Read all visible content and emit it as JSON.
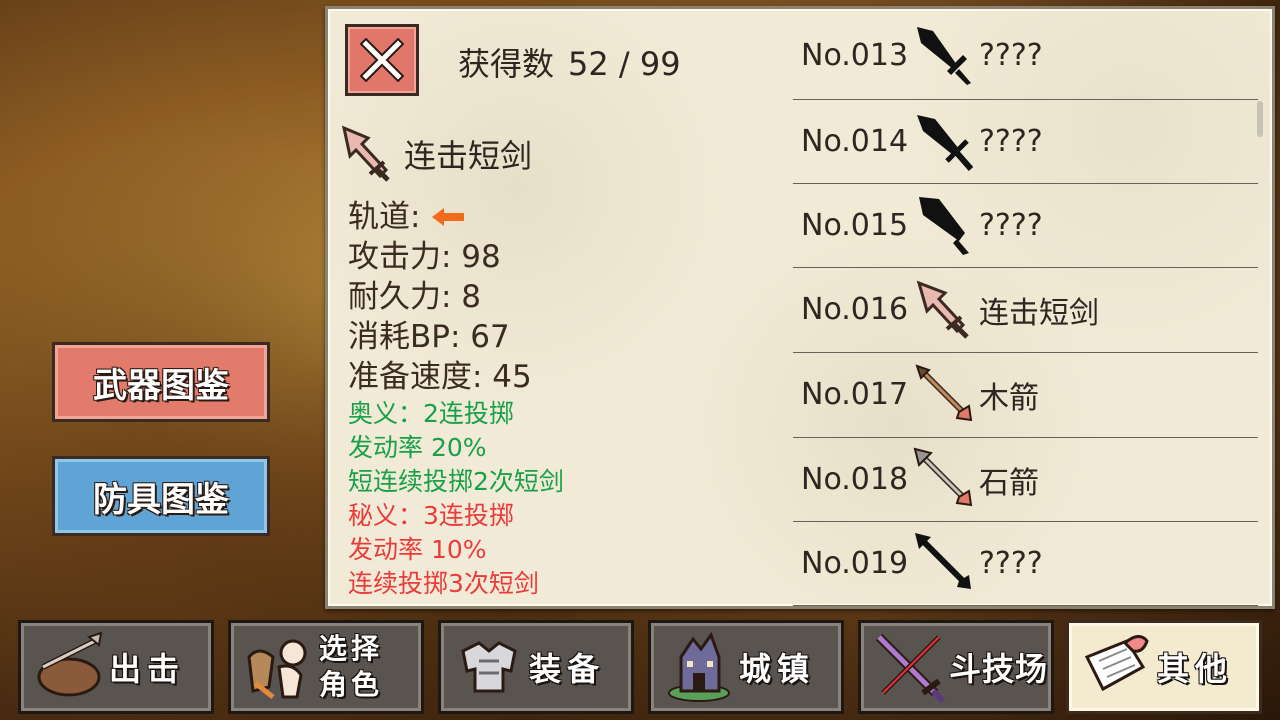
{
  "header": {
    "obtained_label": "获得数",
    "obtained_count": "52 / 99"
  },
  "selected": {
    "name": "连击短剑",
    "track_label": "轨道:",
    "attack": "攻击力: 98",
    "durability": "耐久力: 8",
    "bp_cost": "消耗BP: 67",
    "prep_speed": "准备速度: 45",
    "skill1_title": "奥义：2连投掷",
    "skill1_rate": "发动率 20%",
    "skill1_desc": "短连续投掷2次短剑",
    "skill2_title": "秘义：3连投掷",
    "skill2_rate": "发动率 10%",
    "skill2_desc": "连续投掷3次短剑"
  },
  "list": [
    {
      "no": "No.013",
      "name": "????",
      "icon": "black-sword-icon"
    },
    {
      "no": "No.014",
      "name": "????",
      "icon": "black-dagger-icon"
    },
    {
      "no": "No.015",
      "name": "????",
      "icon": "black-cleaver-icon"
    },
    {
      "no": "No.016",
      "name": "连击短剑",
      "icon": "combo-dagger-icon"
    },
    {
      "no": "No.017",
      "name": "木箭",
      "icon": "wood-arrow-icon"
    },
    {
      "no": "No.018",
      "name": "石箭",
      "icon": "stone-arrow-icon"
    },
    {
      "no": "No.019",
      "name": "????",
      "icon": "black-arrow-icon"
    }
  ],
  "side": {
    "weapon_book": "武器图鉴",
    "armor_book": "防具图鉴"
  },
  "nav": {
    "sortie": "出击",
    "select_char_1": "选择",
    "select_char_2": "角色",
    "equip": "装备",
    "town": "城镇",
    "arena": "斗技场",
    "other": "其他"
  },
  "colors": {
    "skill_green": "#19a04a",
    "skill_red": "#ec3b3b",
    "weapon_btn": "#e27b6b",
    "armor_btn": "#5fa4d4"
  }
}
